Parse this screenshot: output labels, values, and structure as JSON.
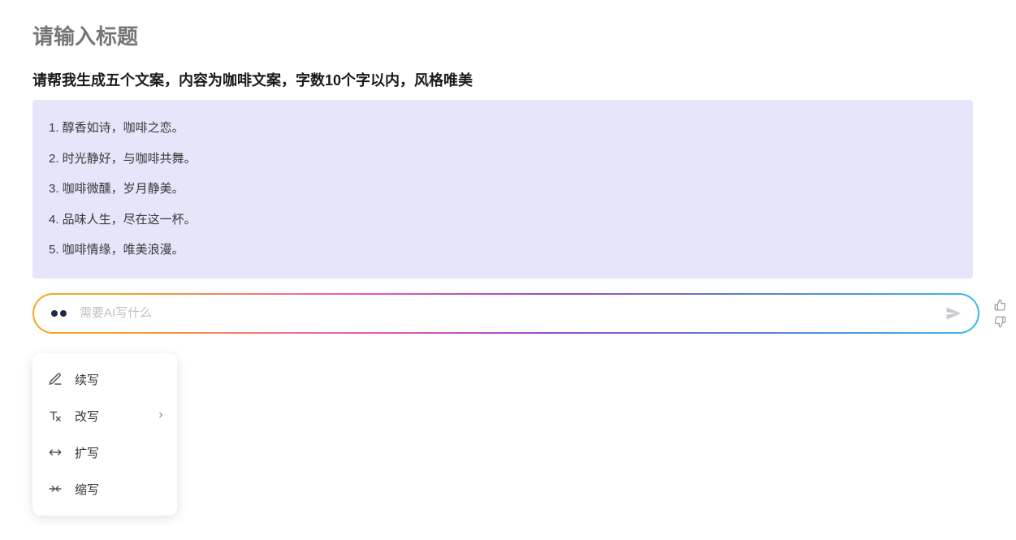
{
  "title": {
    "placeholder": "请输入标题"
  },
  "prompt": "请帮我生成五个文案，内容为咖啡文案，字数10个字以内，风格唯美",
  "responses": [
    "1. 醇香如诗，咖啡之恋。",
    "2. 时光静好，与咖啡共舞。",
    "3. 咖啡微醺，岁月静美。",
    "4. 品味人生，尽在这一杯。",
    "5. 咖啡情缘，唯美浪漫。"
  ],
  "aiInput": {
    "placeholder": "需要AI写什么"
  },
  "menu": {
    "items": [
      {
        "label": "续写",
        "hasSubmenu": false
      },
      {
        "label": "改写",
        "hasSubmenu": true
      },
      {
        "label": "扩写",
        "hasSubmenu": false
      },
      {
        "label": "缩写",
        "hasSubmenu": false
      }
    ]
  }
}
